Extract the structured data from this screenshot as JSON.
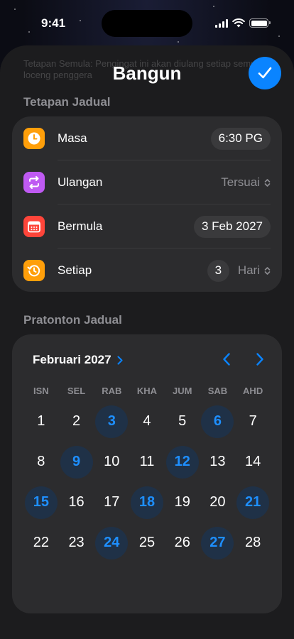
{
  "status_bar": {
    "time": "9:41"
  },
  "sheet": {
    "title": "Bangun",
    "background_hint": "Tetapan Semula: Pengingat ini akan diulang setiap semua loceng penggera"
  },
  "schedule_section": {
    "label": "Tetapan Jadual",
    "rows": [
      {
        "label": "Masa",
        "value": "6:30 PG",
        "icon": "clock-icon",
        "color": "#ff9f0a"
      },
      {
        "label": "Ulangan",
        "value": "Tersuai",
        "icon": "repeat-icon",
        "color": "#bf5af2"
      },
      {
        "label": "Bermula",
        "value": "3 Feb 2027",
        "icon": "calendar-icon",
        "color": "#ff453a"
      },
      {
        "label": "Setiap",
        "count": "3",
        "unit": "Hari",
        "icon": "history-icon",
        "color": "#ff9f0a"
      }
    ]
  },
  "preview_section": {
    "label": "Pratonton Jadual",
    "month": "Februari 2027",
    "weekdays": [
      "ISN",
      "SEL",
      "RAB",
      "KHA",
      "JUM",
      "SAB",
      "AHD"
    ],
    "days": [
      "1",
      "2",
      "3",
      "4",
      "5",
      "6",
      "7",
      "8",
      "9",
      "10",
      "11",
      "12",
      "13",
      "14",
      "15",
      "16",
      "17",
      "18",
      "19",
      "20",
      "21",
      "22",
      "23",
      "24",
      "25",
      "26",
      "27",
      "28"
    ],
    "highlighted": [
      "3",
      "6",
      "9",
      "12",
      "15",
      "18",
      "21",
      "24",
      "27"
    ]
  },
  "colors": {
    "accent": "#0a84ff",
    "card": "#2c2c2e",
    "sheet": "#1c1c1e"
  }
}
